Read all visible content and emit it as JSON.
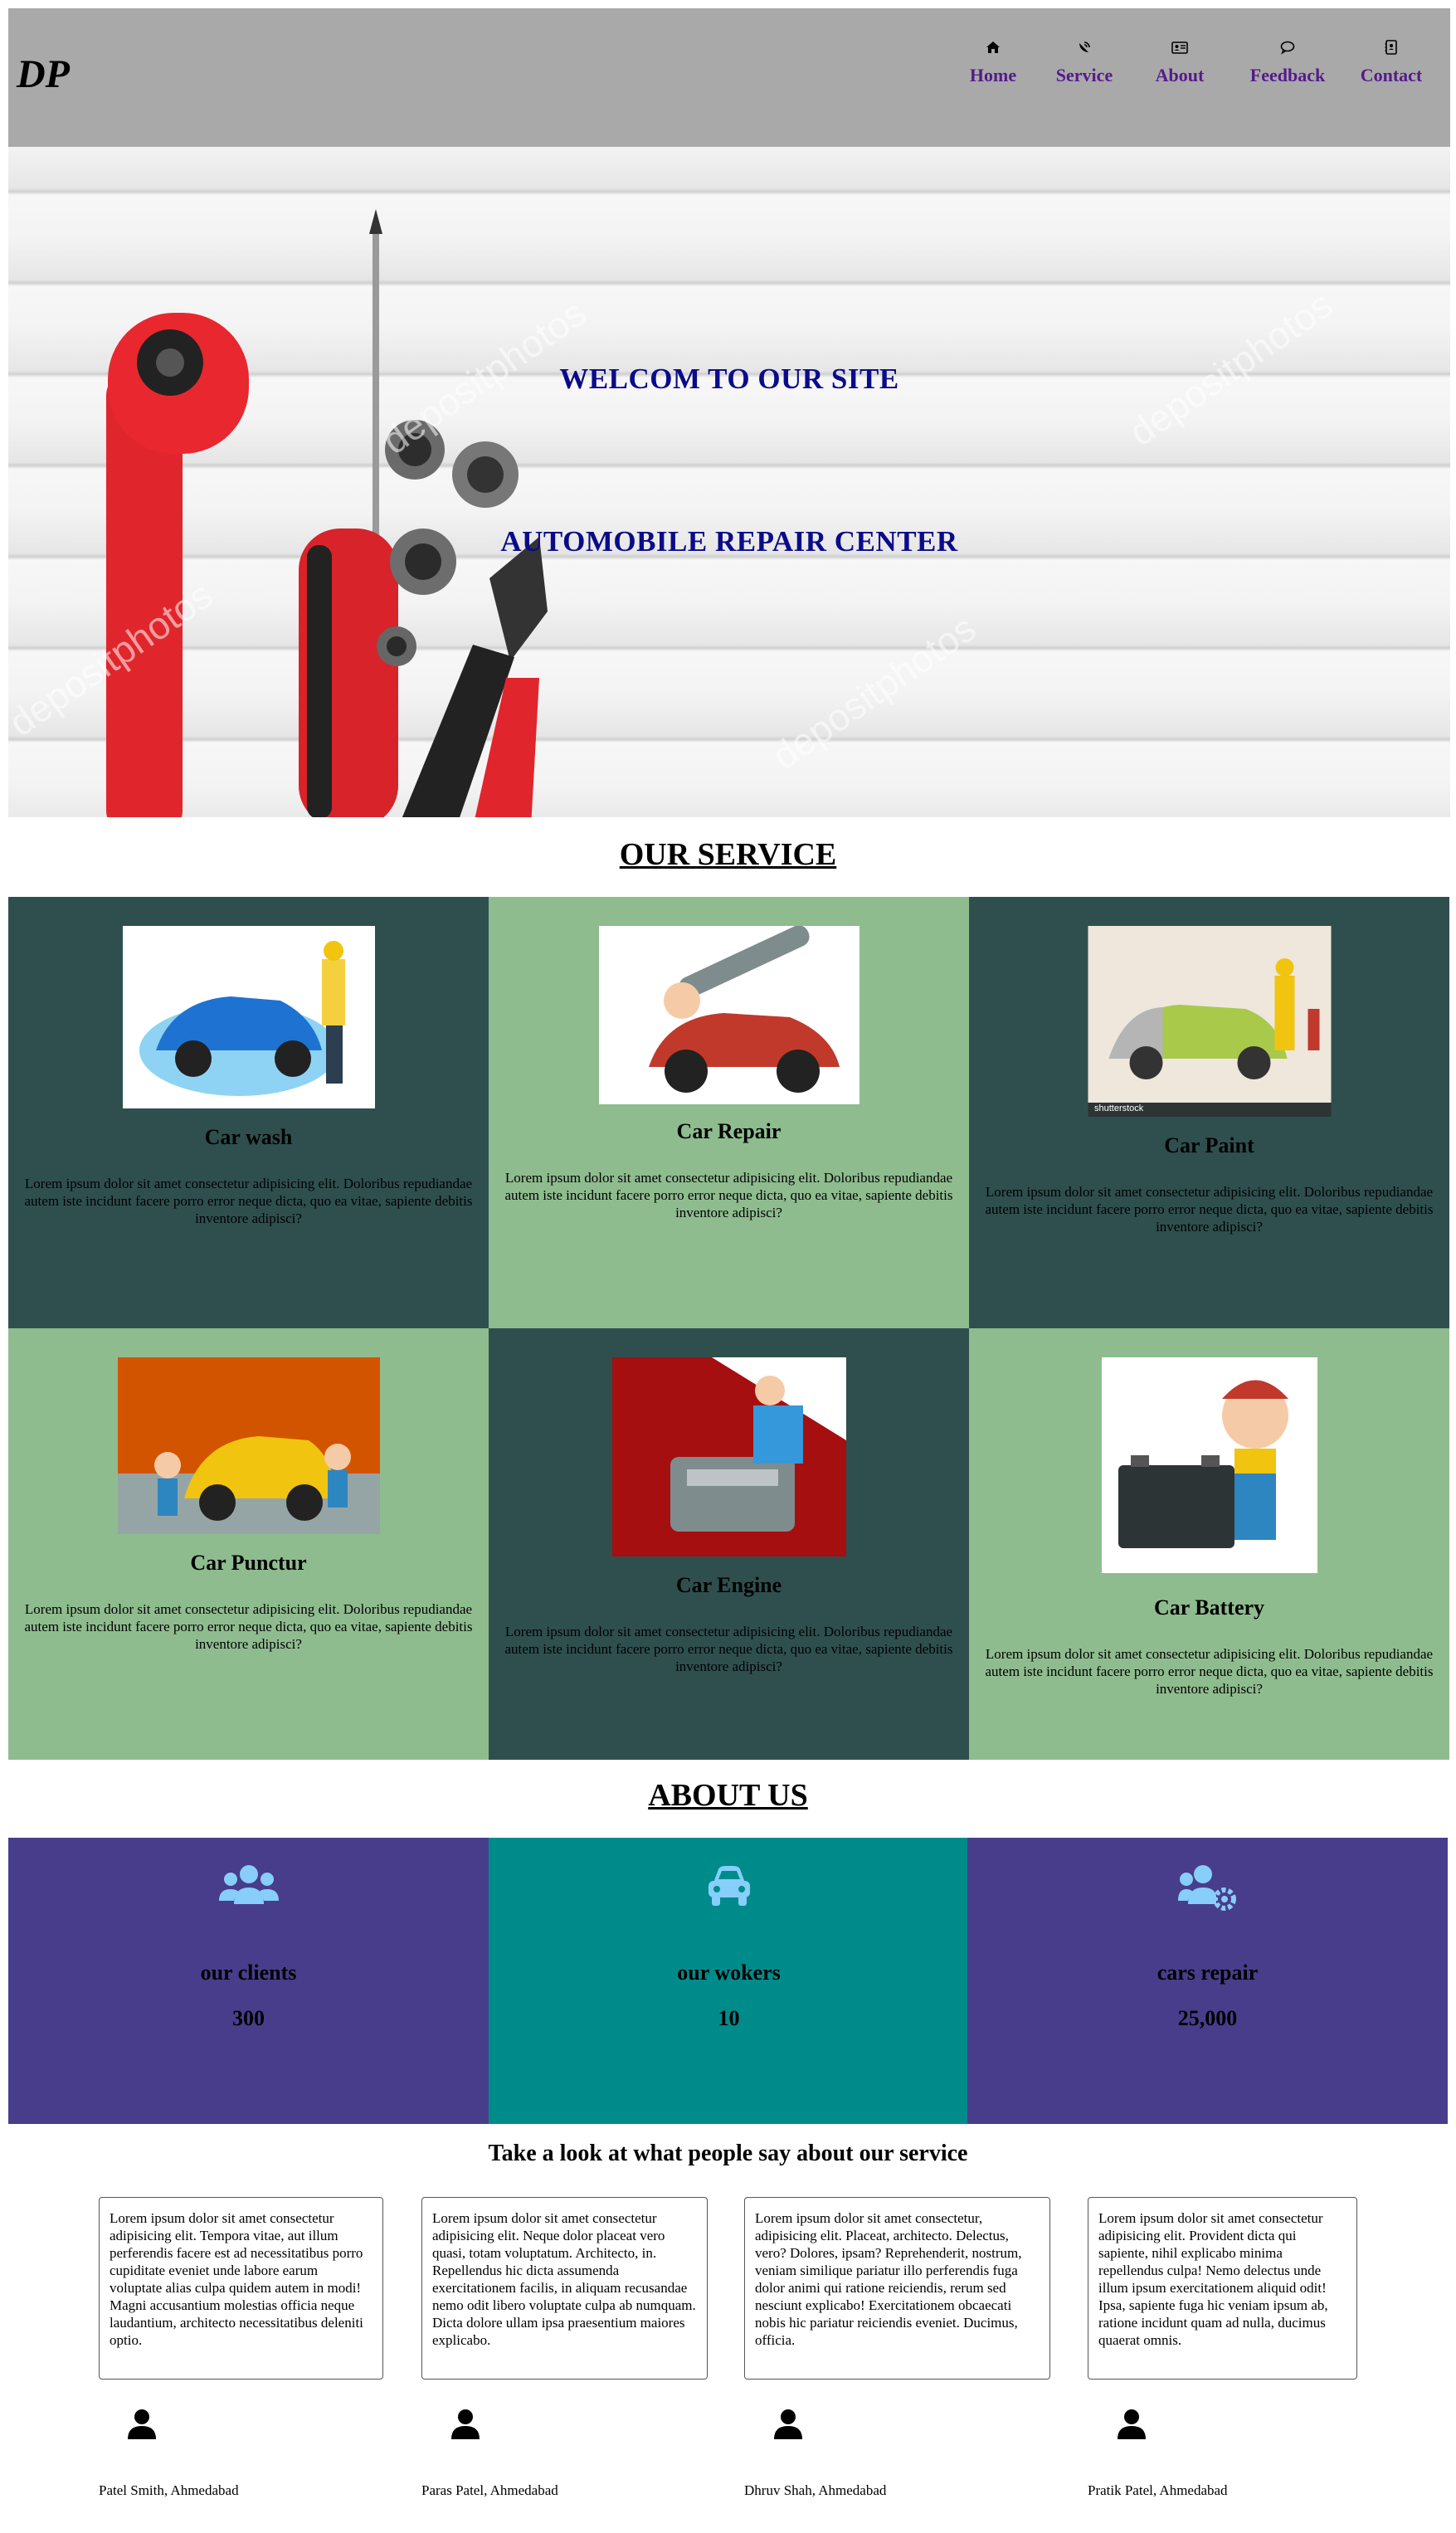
{
  "header": {
    "logo": "DP",
    "nav": [
      {
        "label": "Home",
        "icon": "home-icon"
      },
      {
        "label": "Service",
        "icon": "satellite-dish-icon"
      },
      {
        "label": "About",
        "icon": "address-card-icon"
      },
      {
        "label": "Feedback",
        "icon": "comment-icon"
      },
      {
        "label": "Contact",
        "icon": "address-book-icon"
      }
    ],
    "nav_color": "#551a8b",
    "background": "#a9a9a9"
  },
  "hero": {
    "line1": "WELCOM TO OUR SITE",
    "line2": "AUTOMOBILE REPAIR CENTER",
    "watermark": "depositphotos",
    "title_color": "#0b0b8a"
  },
  "services": {
    "title": "OUR SERVICE",
    "items": [
      {
        "title": "Car wash",
        "text": "Lorem ipsum dolor sit amet consectetur adipisicing elit. Doloribus repudiandae autem iste incidunt facere porro error neque dicta, quo ea vitae, sapiente debitis inventore adipisci?"
      },
      {
        "title": "Car Repair",
        "text": "Lorem ipsum dolor sit amet consectetur adipisicing elit. Doloribus repudiandae autem iste incidunt facere porro error neque dicta, quo ea vitae, sapiente debitis inventore adipisci?"
      },
      {
        "title": "Car Paint",
        "text": "Lorem ipsum dolor sit amet consectetur adipisicing elit. Doloribus repudiandae autem iste incidunt facere porro error neque dicta, quo ea vitae, sapiente debitis inventore adipisci?",
        "image_caption": "shutterstock"
      },
      {
        "title": "Car Punctur",
        "text": "Lorem ipsum dolor sit amet consectetur adipisicing elit. Doloribus repudiandae autem iste incidunt facere porro error neque dicta, quo ea vitae, sapiente debitis inventore adipisci?"
      },
      {
        "title": "Car Engine",
        "text": "Lorem ipsum dolor sit amet consectetur adipisicing elit. Doloribus repudiandae autem iste incidunt facere porro error neque dicta, quo ea vitae, sapiente debitis inventore adipisci?"
      },
      {
        "title": "Car Battery",
        "text": "Lorem ipsum dolor sit amet consectetur adipisicing elit. Doloribus repudiandae autem iste incidunt facere porro error neque dicta, quo ea vitae, sapiente debitis inventore adipisci?"
      }
    ],
    "colors": {
      "dark": "#2f4f4f",
      "light": "#8fbc8f"
    }
  },
  "about": {
    "title": "ABOUT US",
    "stats": [
      {
        "label": "our clients",
        "value": "300",
        "icon": "users-icon",
        "color": "#483d8b"
      },
      {
        "label": "our wokers",
        "value": "10",
        "icon": "car-icon",
        "color": "#008b8b"
      },
      {
        "label": "cars repair",
        "value": "25,000",
        "icon": "users-cog-icon",
        "color": "#483d8b"
      }
    ],
    "icon_color": "#87cefa"
  },
  "testimonials": {
    "heading": "Take a look at what people say about our service",
    "items": [
      {
        "text": "Lorem ipsum dolor sit amet consectetur adipisicing elit. Tempora vitae, aut illum perferendis facere est ad necessitatibus porro cupiditate eveniet unde labore earum voluptate alias culpa quidem autem in modi! Magni accusantium molestias officia neque laudantium, architecto necessitatibus deleniti optio.",
        "name": "Patel Smith, Ahmedabad"
      },
      {
        "text": "Lorem ipsum dolor sit amet consectetur adipisicing elit. Neque dolor placeat vero quasi, totam voluptatum. Architecto, in. Repellendus hic dicta assumenda exercitationem facilis, in aliquam recusandae nemo odit libero voluptate culpa ab numquam. Dicta dolore ullam ipsa praesentium maiores explicabo.",
        "name": "Paras Patel, Ahmedabad"
      },
      {
        "text": "Lorem ipsum dolor sit amet consectetur, adipisicing elit. Placeat, architecto. Delectus, vero? Dolores, ipsam? Reprehenderit, nostrum, veniam similique pariatur illo perferendis fuga dolor animi qui ratione reiciendis, rerum sed nesciunt explicabo! Exercitationem obcaecati nobis hic pariatur reiciendis eveniet. Ducimus, officia.",
        "name": "Dhruv Shah, Ahmedabad"
      },
      {
        "text": "Lorem ipsum dolor sit amet consectetur adipisicing elit. Provident dicta qui sapiente, nihil explicabo minima repellendus culpa! Nemo delectus unde illum ipsum exercitationem aliquid odit! Ipsa, sapiente fuga hic veniam ipsum ab, ratione incidunt quam ad nulla, ducimus quaerat omnis.",
        "name": "Pratik Patel, Ahmedabad"
      }
    ]
  }
}
